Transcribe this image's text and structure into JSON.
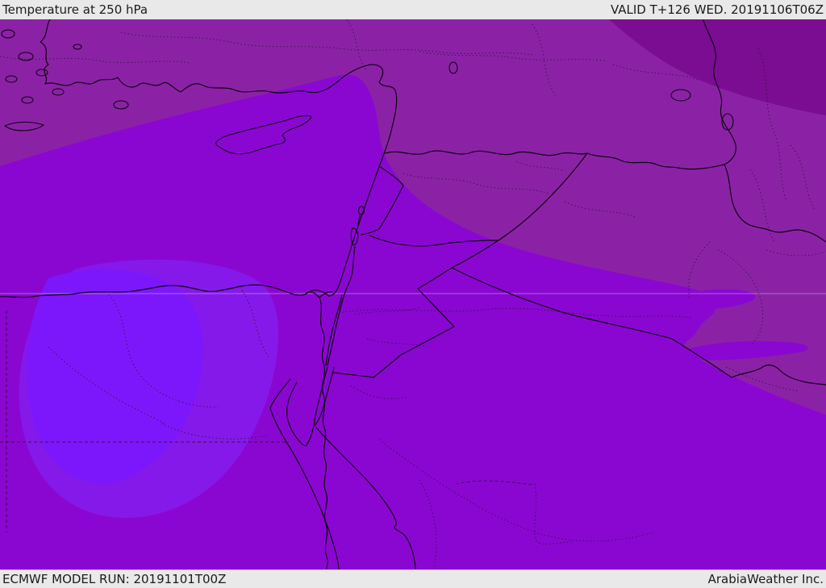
{
  "header": {
    "title": "Temperature at 250 hPa",
    "valid": "VALID T+126 WED. 20191106T06Z"
  },
  "footer": {
    "model_run": "ECMWF MODEL RUN: 20191101T00Z",
    "brand": "ArabiaWeather Inc."
  },
  "palette": {
    "bar_bg": "#e9e9e9",
    "bar_text": "#1b1b1b",
    "main": "#8a07d2",
    "band_warm": "#8b22a6",
    "band_warmest": "#7a0d92",
    "blob_outer": "#8519ea",
    "blob_inner": "#7d17fb",
    "line": "#0f0212",
    "admin_line": "#2a1030",
    "grid_line": "#c9b4ea"
  },
  "map": {
    "type": "weather-contour-map",
    "parameter": "Temperature at 250 hPa",
    "model": "ECMWF",
    "region": "Eastern Mediterranean / Middle East (Turkey, Cyprus, Levant, Egypt, Iraq, northern Saudi Arabia)",
    "bands": [
      {
        "name": "warmest-band",
        "color": "#7a0d92",
        "location": "far northeast corner (NE Turkey / NW Iran)"
      },
      {
        "name": "warm-band",
        "color": "#8b22a6",
        "location": "northern strip across Turkey, NE Syria, Iraq and down the eastern edge"
      },
      {
        "name": "mid-band",
        "color": "#8a07d2",
        "location": "bulk of the map: east Mediterranean, Levant, Jordan, Saudi Arabia, southern Egypt"
      },
      {
        "name": "cool-band",
        "color": "#8519ea",
        "location": "broad blob over central Egypt"
      },
      {
        "name": "coolest-band",
        "color": "#7d17fb",
        "location": "core of the Egypt blob (west-central Egypt)"
      }
    ],
    "gridline": "single faint horizontal latitude line near mid-map",
    "features": [
      "turkey-coast",
      "aegean-islands",
      "crete",
      "cyprus",
      "levant-coast",
      "egypt-coast",
      "nile-river",
      "nile-delta",
      "gulf-of-suez",
      "gulf-of-aqaba",
      "red-sea",
      "dead-sea",
      "sea-of-galilee",
      "lake-van",
      "lake-urmia",
      "lake-tuz",
      "turkey-syria-border",
      "syria-iraq-border",
      "jordan-saudi-border",
      "iraq-saudi-border",
      "iraq-iran-border",
      "egypt-israel-border",
      "dashed-admin-boundaries"
    ]
  }
}
